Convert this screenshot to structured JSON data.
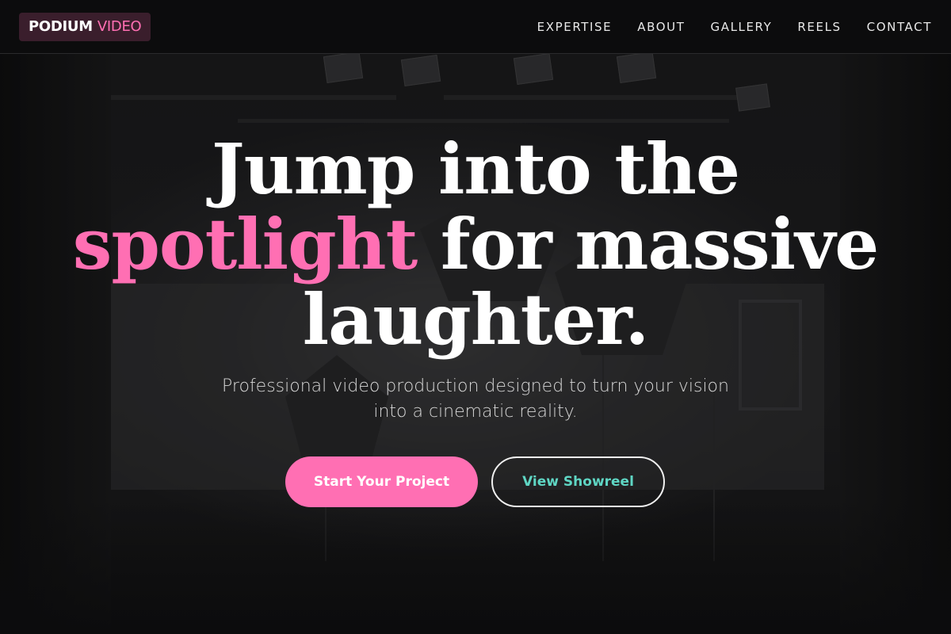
{
  "brand": {
    "logo_part1": "PODIUM",
    "logo_part2": "VIDEO"
  },
  "nav": {
    "items": [
      "EXPERTISE",
      "ABOUT",
      "GALLERY",
      "REELS",
      "CONTACT"
    ]
  },
  "hero": {
    "headline_line1": "Jump into the",
    "headline_highlight": "spotlight",
    "headline_line2_rest": " for massive",
    "headline_line3": "laughter.",
    "subtitle": "Professional video production designed to turn your vision into a cinematic reality.",
    "primary_cta": "Start Your Project",
    "secondary_cta": "View Showreel"
  },
  "colors": {
    "accent_pink": "#ff6fb3",
    "accent_teal": "#5fd6c4",
    "background": "#0f0f10"
  }
}
